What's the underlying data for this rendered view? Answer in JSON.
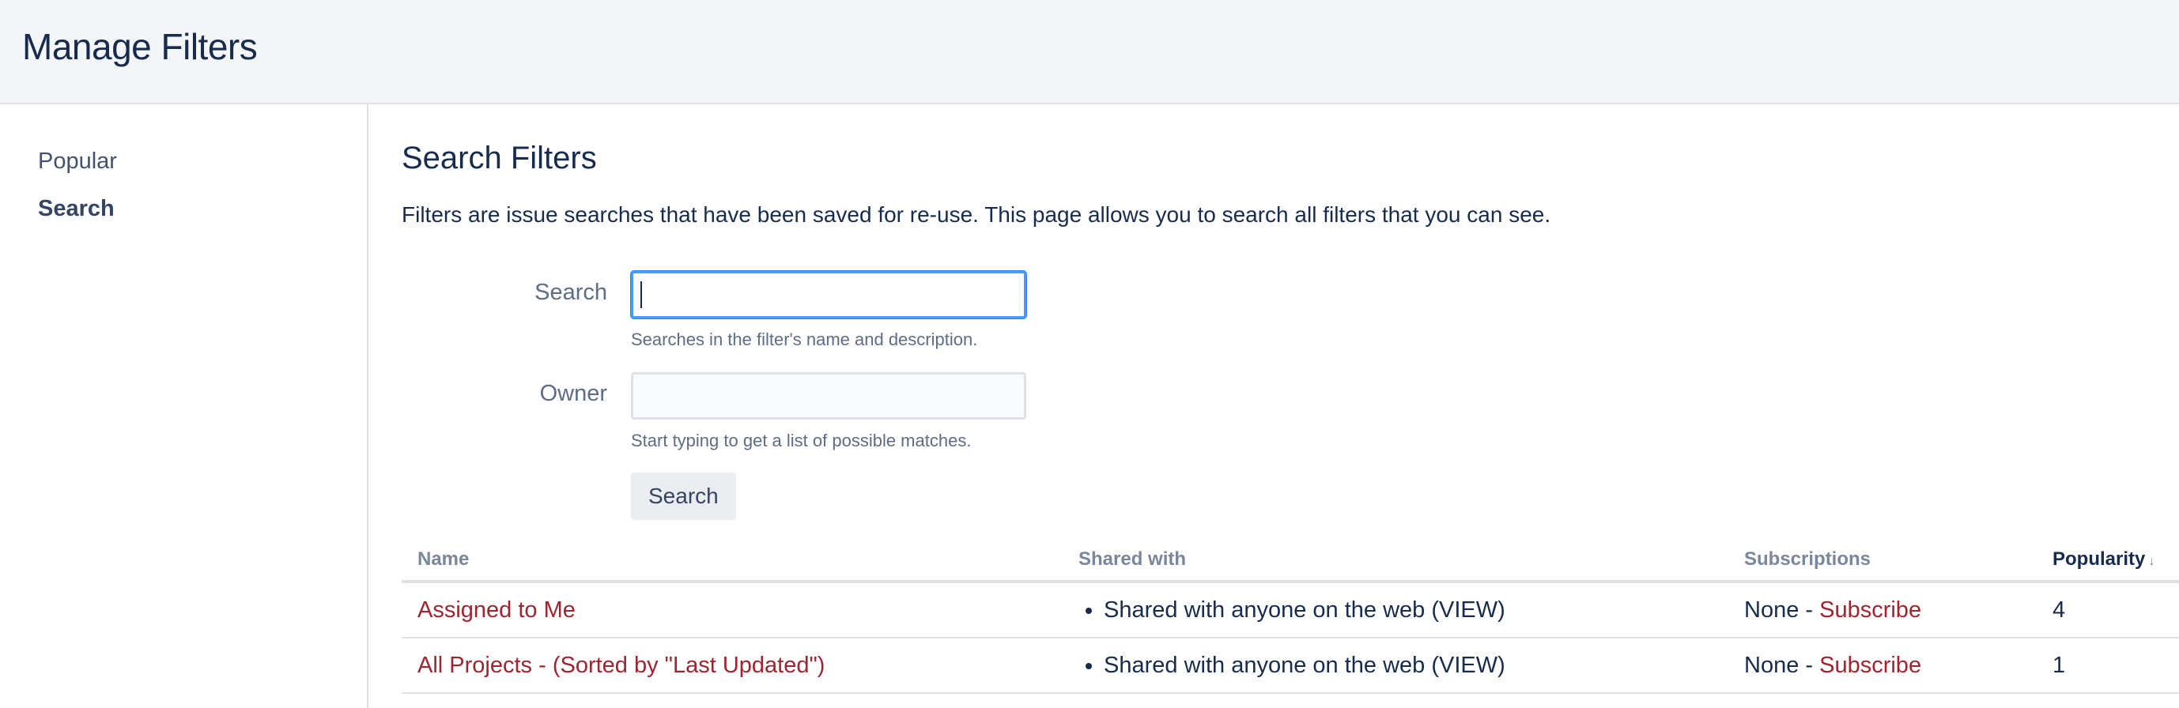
{
  "header": {
    "title": "Manage Filters"
  },
  "sidebar": {
    "items": [
      {
        "label": "Popular",
        "active": false
      },
      {
        "label": "Search",
        "active": true
      }
    ]
  },
  "main": {
    "title": "Search Filters",
    "description": "Filters are issue searches that have been saved for re-use. This page allows you to search all filters that you can see.",
    "form": {
      "search_label": "Search",
      "search_value": "",
      "search_help": "Searches in the filter's name and description.",
      "owner_label": "Owner",
      "owner_value": "",
      "owner_help": "Start typing to get a list of possible matches.",
      "submit_label": "Search"
    },
    "table": {
      "columns": [
        "Name",
        "Shared with",
        "Subscriptions",
        "Popularity"
      ],
      "sorted_column": "Popularity",
      "sort_direction": "descending",
      "rows": [
        {
          "name": "Assigned to Me",
          "shared_with": "Shared with anyone on the web (VIEW)",
          "subscriptions_prefix": "None - ",
          "subscribe_link": "Subscribe",
          "popularity": "4"
        },
        {
          "name": "All Projects - (Sorted by \"Last Updated\")",
          "shared_with": "Shared with anyone on the web (VIEW)",
          "subscriptions_prefix": "None - ",
          "subscribe_link": "Subscribe",
          "popularity": "1"
        }
      ]
    }
  },
  "colors": {
    "link": "#a0242f",
    "heading": "#172b4d",
    "focus_border": "#4c9aff",
    "header_bg": "#f4f5f7"
  }
}
